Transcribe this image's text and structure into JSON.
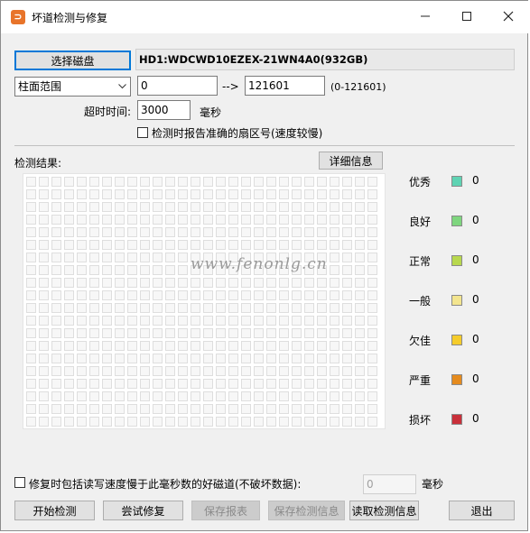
{
  "window": {
    "title": "坏道检测与修复"
  },
  "disk": {
    "select_label": "选择磁盘",
    "name": "HD1:WDCWD10EZEX-21WN4A0(932GB)"
  },
  "range": {
    "mode": "柱面范围",
    "start": "0",
    "arrow": "-->",
    "end": "121601",
    "hint": "(0-121601)"
  },
  "timeout": {
    "label": "超时时间:",
    "value": "3000",
    "unit": "毫秒"
  },
  "options": {
    "report_sector": "检测时报告准确的扇区号(速度较慢)"
  },
  "results": {
    "label": "检测结果:",
    "detail_button": "详细信息",
    "watermark": "www.fenonlg.cn"
  },
  "legend": [
    {
      "label": "优秀",
      "color": "#5fd3b3",
      "count": "0"
    },
    {
      "label": "良好",
      "color": "#7fd67f",
      "count": "0"
    },
    {
      "label": "正常",
      "color": "#b8d84e",
      "count": "0"
    },
    {
      "label": "一般",
      "color": "#f3e58f",
      "count": "0"
    },
    {
      "label": "欠佳",
      "color": "#f5cc2b",
      "count": "0"
    },
    {
      "label": "严重",
      "color": "#e58b1e",
      "count": "0"
    },
    {
      "label": "损坏",
      "color": "#c9303a",
      "count": "0"
    }
  ],
  "repair": {
    "label": "修复时包括读写速度慢于此毫秒数的好磁道(不破坏数据):",
    "value": "0",
    "unit": "毫秒"
  },
  "buttons": {
    "start": "开始检测",
    "try_repair": "尝试修复",
    "save_report": "保存报表",
    "save_info": "保存检测信息",
    "read_info": "读取检测信息",
    "exit": "退出"
  }
}
